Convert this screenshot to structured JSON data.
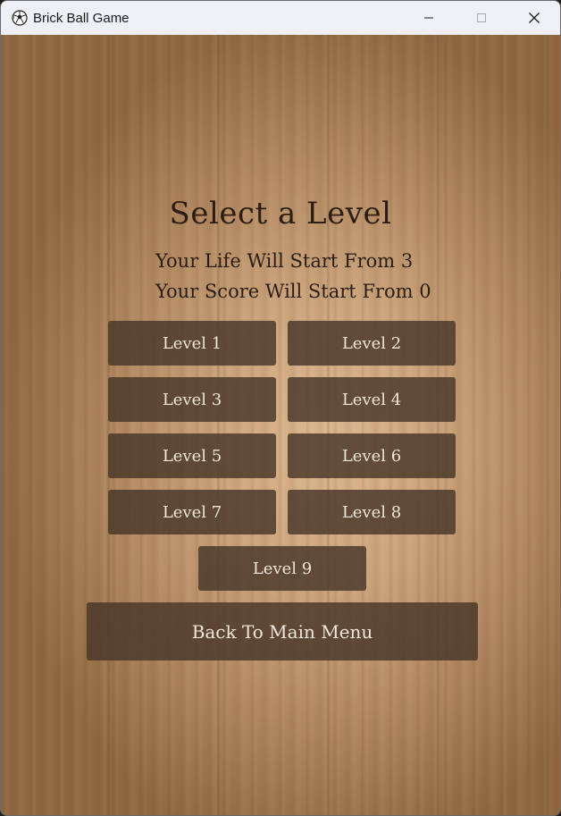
{
  "window": {
    "title": "Brick Ball Game",
    "app_icon": "soccer-ball-icon",
    "controls": [
      "minimize-icon",
      "maximize-icon",
      "close-icon"
    ]
  },
  "screen": {
    "heading": "Select a Level",
    "life_text": "Your Life Will Start From 3",
    "score_text": "Your Score Will Start From 0"
  },
  "levels": [
    {
      "label": "Level 1"
    },
    {
      "label": "Level 2"
    },
    {
      "label": "Level 3"
    },
    {
      "label": "Level 4"
    },
    {
      "label": "Level 5"
    },
    {
      "label": "Level 6"
    },
    {
      "label": "Level 7"
    },
    {
      "label": "Level 8"
    },
    {
      "label": "Level 9"
    }
  ],
  "back_button": {
    "label": "Back To Main Menu"
  },
  "colors": {
    "button_fill": "#4a3828",
    "button_text": "#f1e6d8",
    "heading_text": "#2b1d12",
    "titlebar": "#eef0f6"
  }
}
